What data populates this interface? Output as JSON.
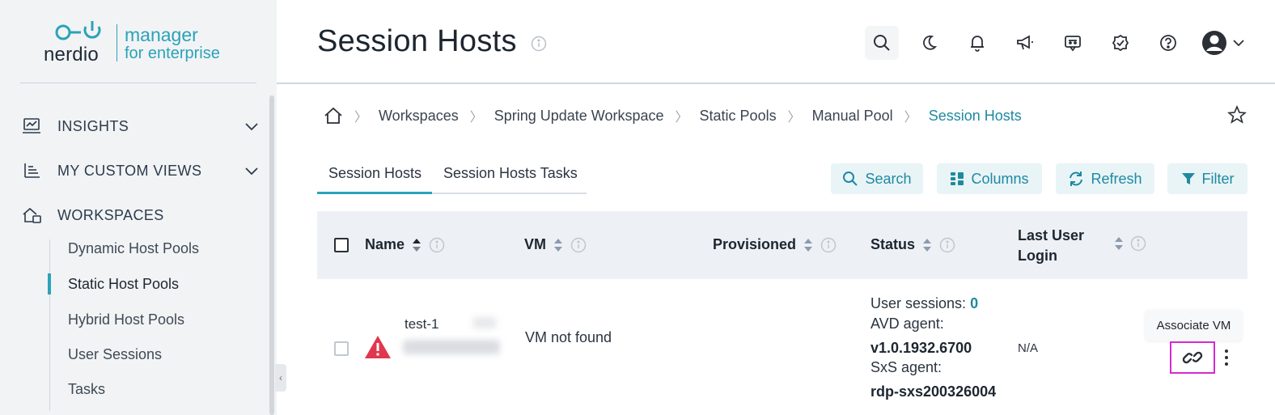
{
  "brand": {
    "name": "nerdio",
    "product_line1": "manager",
    "product_line2": "for enterprise",
    "accent_color": "#2aa3b8"
  },
  "sidebar": {
    "sections": [
      {
        "label": "INSIGHTS",
        "icon": "insights-icon",
        "expandable": true
      },
      {
        "label": "MY CUSTOM VIEWS",
        "icon": "custom-views-icon",
        "expandable": true
      },
      {
        "label": "WORKSPACES",
        "icon": "workspaces-icon",
        "expandable": false
      }
    ],
    "workspace_items": [
      {
        "label": "Dynamic Host Pools",
        "active": false
      },
      {
        "label": "Static Host Pools",
        "active": true
      },
      {
        "label": "Hybrid Host Pools",
        "active": false
      },
      {
        "label": "User Sessions",
        "active": false
      },
      {
        "label": "Tasks",
        "active": false
      }
    ]
  },
  "header": {
    "title": "Session Hosts",
    "icons": [
      "search-icon",
      "moon-icon",
      "bell-icon",
      "megaphone-icon",
      "chat-bot-icon",
      "badge-check-icon",
      "help-icon",
      "user-avatar-icon"
    ]
  },
  "breadcrumb": {
    "items": [
      "Workspaces",
      "Spring Update Workspace",
      "Static Pools",
      "Manual Pool"
    ],
    "current": "Session Hosts"
  },
  "tabs": [
    {
      "label": "Session Hosts",
      "active": true
    },
    {
      "label": "Session Hosts Tasks",
      "active": false
    }
  ],
  "toolbar": {
    "search": "Search",
    "columns": "Columns",
    "refresh": "Refresh",
    "filter": "Filter"
  },
  "table": {
    "columns": {
      "name": "Name",
      "vm": "VM",
      "provisioned": "Provisioned",
      "status": "Status",
      "last_login_line1": "Last User",
      "last_login_line2": "Login"
    },
    "row": {
      "name": "test-1",
      "vm": "VM not found",
      "status_sessions_label": "User sessions:",
      "status_sessions_value": "0",
      "avd_label": "AVD agent:",
      "avd_value": "v1.0.1932.6700",
      "sxs_label": "SxS agent:",
      "sxs_value": "rdp-sxs200326004",
      "last_login": "N/A"
    }
  },
  "tooltip": "Associate VM"
}
